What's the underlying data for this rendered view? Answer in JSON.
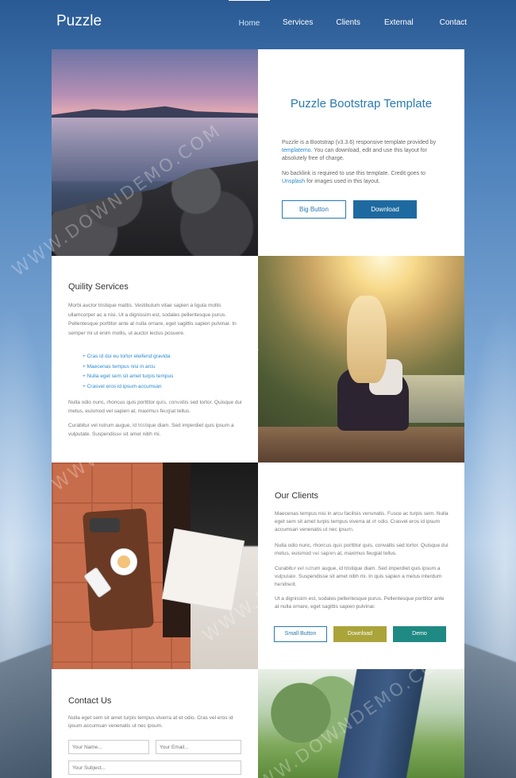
{
  "brand": "Puzzle",
  "nav": {
    "items": [
      "Home",
      "Services",
      "Clients",
      "External",
      "Contact"
    ],
    "active": "Home"
  },
  "intro": {
    "title": "Puzzle Bootstrap Template",
    "p1_before": "Puzzle is a Bootstrap (v3.3.6) responsive template provided by ",
    "p1_link": "templatemo",
    "p1_after": ". You can download, edit and use this layout for absolutely free of charge.",
    "p2_before": "No backlink is required to use this template. Credit goes to ",
    "p2_link": "Unsplash",
    "p2_after": " for images used in this layout.",
    "btn_big": "Big Button",
    "btn_download": "Download"
  },
  "services": {
    "title": "Quility Services",
    "p1": "Morbi auctor tristique mattis. Vestibulum vitae sapien a ligula mollis ullamcorper ac a nisi. Ut a dignissim est, sodales pellentesque purus. Pellentesque porttitor ante at nulla ornare, eget sagittis sapien pulvinar. In semper mi ut enim mollis, ut auctor lectus posuere.",
    "list": [
      "Cras id dui eu tortor eleifend gravida",
      "Maecenas tempus nisi in arcu",
      "Nulla eget sem sit amet turpis tempus",
      "Crasvel eros id ipsum accumsan"
    ],
    "p2": "Nulla odio nunc, rhoncus quis porttitor quis, convallis sed tortor. Quisque dui metus, euismod vel sapien at, maximus feugiat tellus.",
    "p3": "Curabitur vel rutrum augue, id tristique diam. Sed imperdiet quis ipsum a vulputate. Suspendisse sit amet nibh mi."
  },
  "clients": {
    "title": "Our Clients",
    "p1": "Maecenas tempus nisi in arcu facilisis venenatis. Fusce ac turpis sem. Nulla eget sem sit amet turpis tempus viverra at et odio. Crasvel eros id ipsum accumsan venenatis ut nec ipsum.",
    "p2": "Nulla odio nunc, rhoncus quis porttitor quis, convallis sed tortor. Quisque dui metus, euismod vel sapien at, maximus feugiat tellus.",
    "p3": "Curabitur vel rutrum augue, id tristique diam. Sed imperdiet quis ipsum a vulputate. Suspendisse sit amet nibh mi. In quis sapien a metus interdum hendrerit.",
    "p4": "Ut a dignissim est, sodales pellentesque purus. Pellentesque porttitor ante at nulla ornare, eget sagittis sapien pulvinar.",
    "btn_small": "Small Button",
    "btn_download": "Download",
    "btn_demo": "Demo"
  },
  "contact": {
    "title": "Contact Us",
    "p": "Nulla eget sem sit amet turpis tempus viverra at et odio. Cras vel eros id ipsum accumsan venenatis ut nec ipsum.",
    "name_placeholder": "Your Name...",
    "email_placeholder": "Your Email...",
    "subject_placeholder": "Your Subject..."
  },
  "watermark": "WWW.DOWNDEMO.COM",
  "colors": {
    "accent_blue": "#2a7ab0",
    "download_blue": "#1e6aa0",
    "olive": "#aaa43a",
    "teal": "#1f8a83"
  }
}
